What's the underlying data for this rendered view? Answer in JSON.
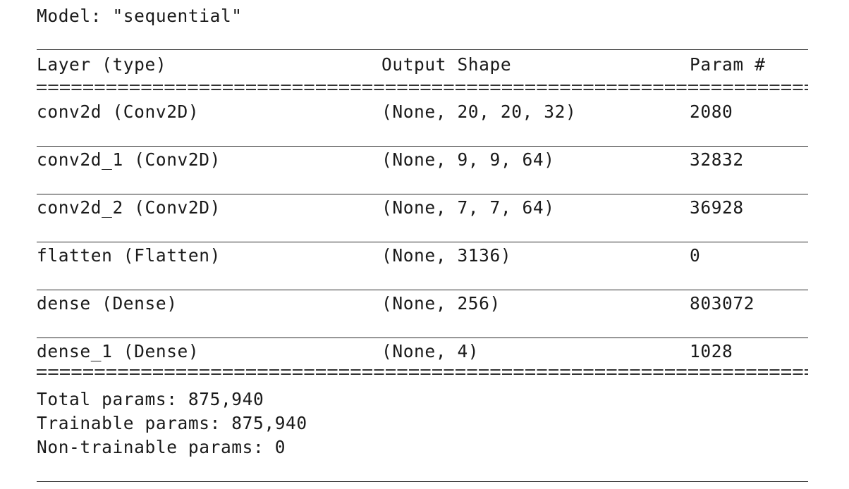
{
  "model_line": "Model: \"sequential\"",
  "header": {
    "layer": "Layer (type)",
    "shape": "Output Shape",
    "param": "Param #"
  },
  "rows": [
    {
      "layer": "conv2d (Conv2D)",
      "shape": "(None, 20, 20, 32)",
      "param": "2080"
    },
    {
      "layer": "conv2d_1 (Conv2D)",
      "shape": "(None, 9, 9, 64)",
      "param": "32832"
    },
    {
      "layer": "conv2d_2 (Conv2D)",
      "shape": "(None, 7, 7, 64)",
      "param": "36928"
    },
    {
      "layer": "flatten (Flatten)",
      "shape": "(None, 3136)",
      "param": "0"
    },
    {
      "layer": "dense (Dense)",
      "shape": "(None, 256)",
      "param": "803072"
    },
    {
      "layer": "dense_1 (Dense)",
      "shape": "(None, 4)",
      "param": "1028"
    }
  ],
  "summary": {
    "total": "Total params: 875,940",
    "trainable": "Trainable params: 875,940",
    "non_trainable": "Non-trainable params: 0"
  }
}
